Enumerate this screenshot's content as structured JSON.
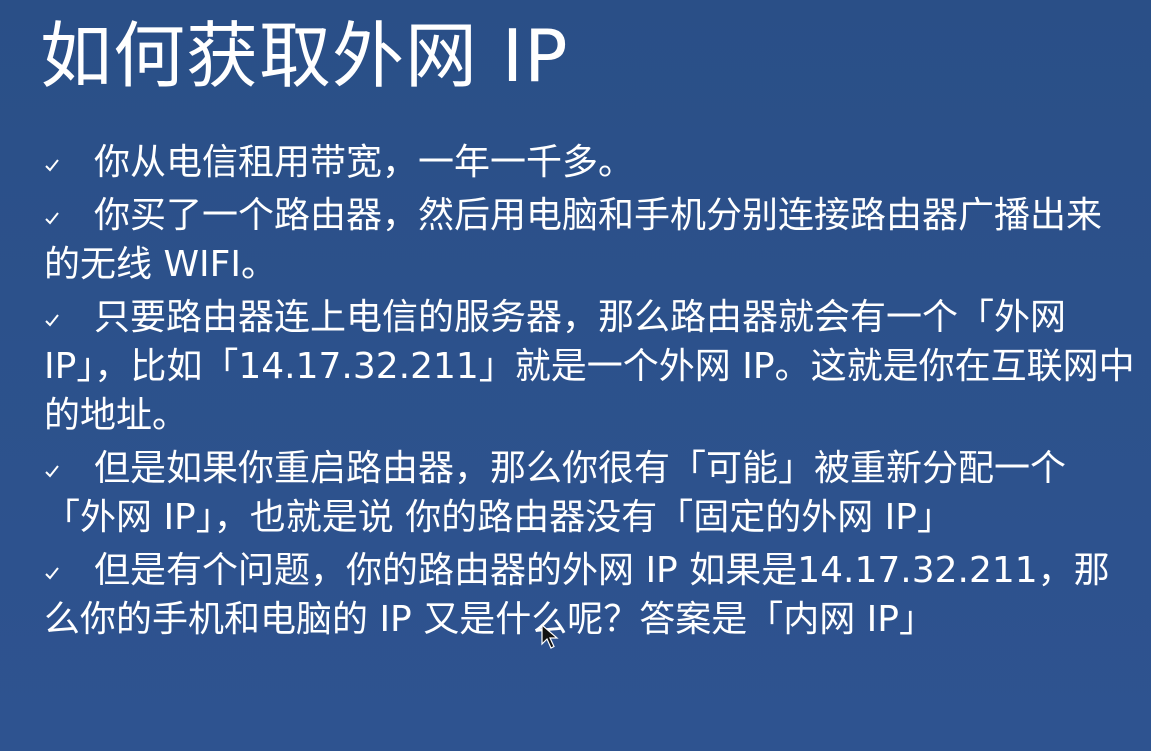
{
  "slide": {
    "title": "如何获取外网 IP",
    "bullets": [
      {
        "text": "你从电信租用带宽，一年一千多。",
        "icon": "check-icon"
      },
      {
        "text": "你买了一个路由器，然后用电脑和手机分别连接路由器广播出来的无线 WIFI。",
        "icon": "check-icon"
      },
      {
        "text": "只要路由器连上电信的服务器，那么路由器就会有一个「外网 IP」，比如「14.17.32.211」就是一个外网 IP。这就是你在互联网中的地址。",
        "icon": "check-icon"
      },
      {
        "text": "但是如果你重启路由器，那么你很有「可能」被重新分配一个「外网 IP」，也就是说 你的路由器没有「固定的外网 IP」",
        "icon": "check-icon"
      },
      {
        "text": "但是有个问题，你的路由器的外网 IP 如果是14.17.32.211，那么你的手机和电脑的 IP 又是什么呢？答案是「内网 IP」",
        "icon": "check-icon"
      }
    ],
    "colors": {
      "background": "#2c518b",
      "text": "#ffffff"
    },
    "cursor_icon": "mouse-pointer-icon"
  }
}
